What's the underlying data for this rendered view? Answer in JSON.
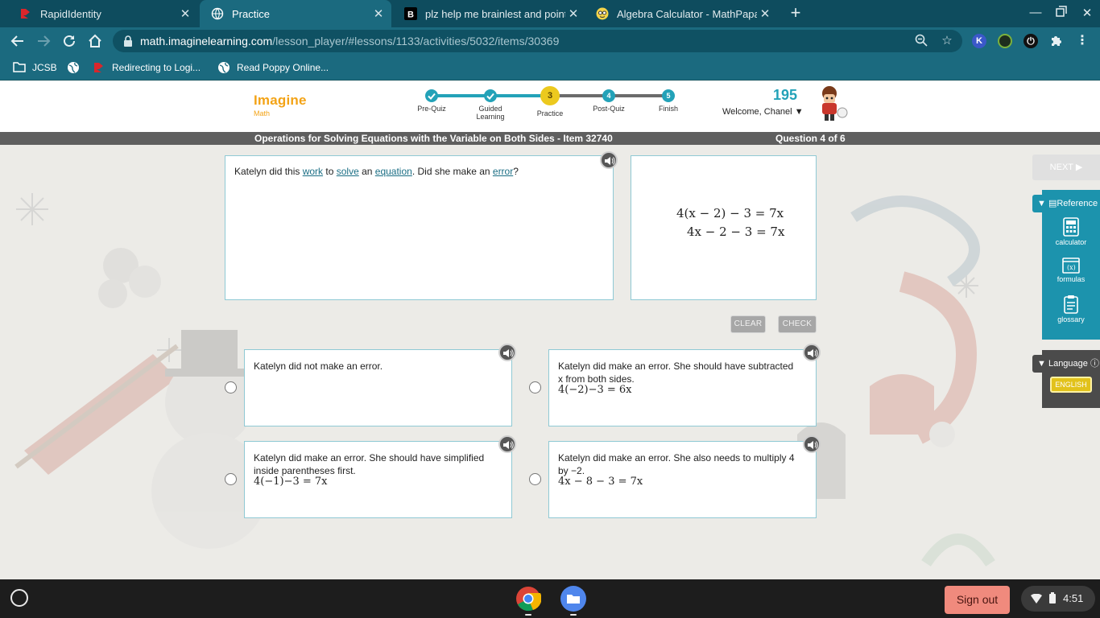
{
  "browser": {
    "tabs": [
      {
        "title": "RapidIdentity",
        "active": false,
        "favicon": "rapididentity-icon"
      },
      {
        "title": "Practice",
        "active": true,
        "favicon": "globe-icon"
      },
      {
        "title": "plz help me brainlest and points",
        "active": false,
        "favicon": "brainly-icon"
      },
      {
        "title": "Algebra Calculator - MathPapa",
        "active": false,
        "favicon": "mathpapa-icon"
      }
    ],
    "url_host": "math.imaginelearning.com",
    "url_path": "/lesson_player/#lessons/1133/activities/5032/items/30369",
    "bookmarks": [
      "JCSB",
      "Redirecting to Logi...",
      "Read Poppy Online..."
    ],
    "extensions": [
      "K"
    ]
  },
  "app": {
    "logo_main": "Imagine",
    "logo_sub": "Math",
    "steps": [
      {
        "number": "",
        "label": "Pre-Quiz",
        "state": "done"
      },
      {
        "number": "",
        "label": "Guided Learning",
        "state": "done"
      },
      {
        "number": "3",
        "label": "Practice",
        "state": "current"
      },
      {
        "number": "4",
        "label": "Post-Quiz",
        "state": "upcoming"
      },
      {
        "number": "5",
        "label": "Finish",
        "state": "upcoming"
      }
    ],
    "score": "195",
    "welcome": "Welcome, Chanel",
    "lesson_title": "Operations for Solving Equations with the Variable on Both Sides - Item 32740",
    "question_counter": "Question 4 of 6"
  },
  "question": {
    "prompt_parts": [
      "Katelyn did this ",
      "work",
      " to ",
      "solve",
      " an ",
      "equation",
      ". Did she make an ",
      "error",
      "?"
    ],
    "work_lines": [
      "4(x − 2) − 3 = 7x",
      "4x − 2 − 3 = 7x"
    ],
    "clear_label": "CLEAR",
    "check_label": "CHECK",
    "choices": [
      {
        "text": "Katelyn did not make an error.",
        "math": ""
      },
      {
        "text": "Katelyn did make an error. She should have subtracted x from both sides.",
        "math": "4(−2)−3 = 6x"
      },
      {
        "text": "Katelyn did make an error. She should have simplified inside parentheses first.",
        "math": "4(−1)−3 = 7x"
      },
      {
        "text": "Katelyn did make an error. She also needs to multiply 4 by −2.",
        "math": "4x − 8 − 3 = 7x"
      }
    ]
  },
  "sidebar": {
    "next_label": "NEXT ▶",
    "reference_label": "Reference",
    "tools": [
      "calculator",
      "formulas",
      "glossary"
    ],
    "language_label": "Language",
    "language_value": "ENGLISH"
  },
  "shelf": {
    "signout_label": "Sign out",
    "time": "4:51"
  },
  "colors": {
    "chrome_dark": "#0e4c5e",
    "chrome": "#1b6a7f",
    "accent": "#23a2b8",
    "logo": "#f3a316",
    "current_step": "#ecc91e",
    "reference_panel": "#1c93ad"
  }
}
